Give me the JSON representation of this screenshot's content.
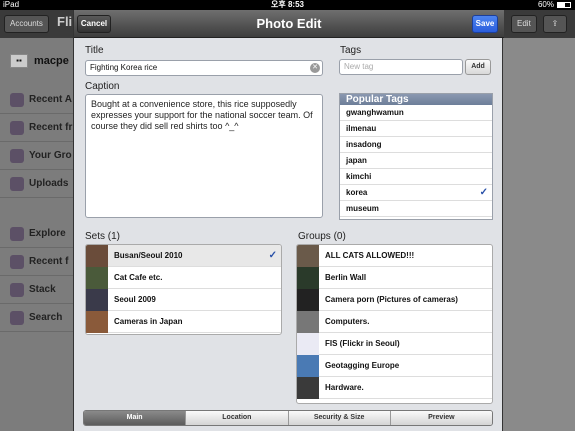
{
  "status": {
    "device": "iPad",
    "time": "오후 8:53",
    "battery": "60%",
    "battery_level": 0.6
  },
  "background": {
    "accounts_label": "Accounts",
    "title": "Fli",
    "edit_label": "Edit",
    "user": "macpe",
    "sidebar": [
      {
        "label": "Recent A"
      },
      {
        "label": "Recent fr"
      },
      {
        "label": "Your Gro"
      },
      {
        "label": "Uploads"
      },
      {
        "label": "Explore"
      },
      {
        "label": "Recent f"
      },
      {
        "label": "Stack"
      },
      {
        "label": "Search"
      }
    ]
  },
  "modal": {
    "title": "Photo Edit",
    "cancel_label": "Cancel",
    "save_label": "Save",
    "title_label": "Title",
    "title_value": "Fighting Korea rice",
    "tags_label": "Tags",
    "new_tag_placeholder": "New tag",
    "add_label": "Add",
    "caption_label": "Caption",
    "caption_text": "Bought at a convenience store, this rice supposedly expresses your support for the national soccer team. Of course they did sell red shirts too ^_^",
    "popular_tags_label": "Popular Tags",
    "popular_tags": [
      {
        "name": "gwanghwamun",
        "checked": false
      },
      {
        "name": "ilmenau",
        "checked": false
      },
      {
        "name": "insadong",
        "checked": false
      },
      {
        "name": "japan",
        "checked": false
      },
      {
        "name": "kimchi",
        "checked": false
      },
      {
        "name": "korea",
        "checked": true
      },
      {
        "name": "museum",
        "checked": false
      }
    ],
    "sets_label": "Sets (1)",
    "sets": [
      {
        "name": "Busan/Seoul 2010",
        "checked": true,
        "color": "#6a4c3a"
      },
      {
        "name": "Cat Cafe etc.",
        "checked": false,
        "color": "#4a5a3a"
      },
      {
        "name": "Seoul 2009",
        "checked": false,
        "color": "#3a3a4a"
      },
      {
        "name": "Cameras in Japan",
        "checked": false,
        "color": "#8a5a3a"
      }
    ],
    "groups_label": "Groups (0)",
    "groups": [
      {
        "name": "ALL CATS ALLOWED!!!",
        "color": "#6a5a4a"
      },
      {
        "name": "Berlin Wall",
        "color": "#2a3a2a"
      },
      {
        "name": "Camera porn (Pictures of cameras)",
        "color": "#222222"
      },
      {
        "name": "Computers.",
        "color": "#777777"
      },
      {
        "name": "FIS (Flickr in Seoul)",
        "color": "#eaeaf4"
      },
      {
        "name": "Geotagging Europe",
        "color": "#4a7ab4"
      },
      {
        "name": "Hardware.",
        "color": "#3a3a3a"
      }
    ],
    "tabs": [
      {
        "label": "Main",
        "active": true
      },
      {
        "label": "Location",
        "active": false
      },
      {
        "label": "Security & Size",
        "active": false
      },
      {
        "label": "Preview",
        "active": false
      }
    ]
  }
}
